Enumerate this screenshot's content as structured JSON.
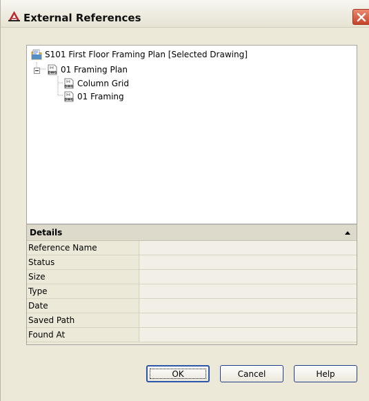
{
  "window": {
    "title": "External References",
    "icon": "autocad-app-icon",
    "close_icon": "close-icon"
  },
  "tree": {
    "root": {
      "label": "S101 First Floor Framing Plan [Selected Drawing]",
      "icon": "drawing-folder-icon"
    },
    "children": [
      {
        "label": "01 Framing Plan",
        "icon": "dwg-file-icon",
        "expanded": true,
        "children": [
          {
            "label": "Column Grid",
            "icon": "dwg-file-icon"
          },
          {
            "label": "01 Framing",
            "icon": "dwg-file-icon"
          }
        ]
      }
    ]
  },
  "details": {
    "title": "Details",
    "collapse_icon": "collapse-up-icon",
    "properties": [
      {
        "name": "Reference Name",
        "value": ""
      },
      {
        "name": "Status",
        "value": ""
      },
      {
        "name": "Size",
        "value": ""
      },
      {
        "name": "Type",
        "value": ""
      },
      {
        "name": "Date",
        "value": ""
      },
      {
        "name": "Saved Path",
        "value": ""
      },
      {
        "name": "Found At",
        "value": ""
      }
    ]
  },
  "buttons": {
    "ok": "OK",
    "cancel": "Cancel",
    "help": "Help"
  },
  "colors": {
    "dialog_bg": "#ece9d8",
    "close_button": "#c8432a",
    "button_border": "#1f3f8c"
  }
}
